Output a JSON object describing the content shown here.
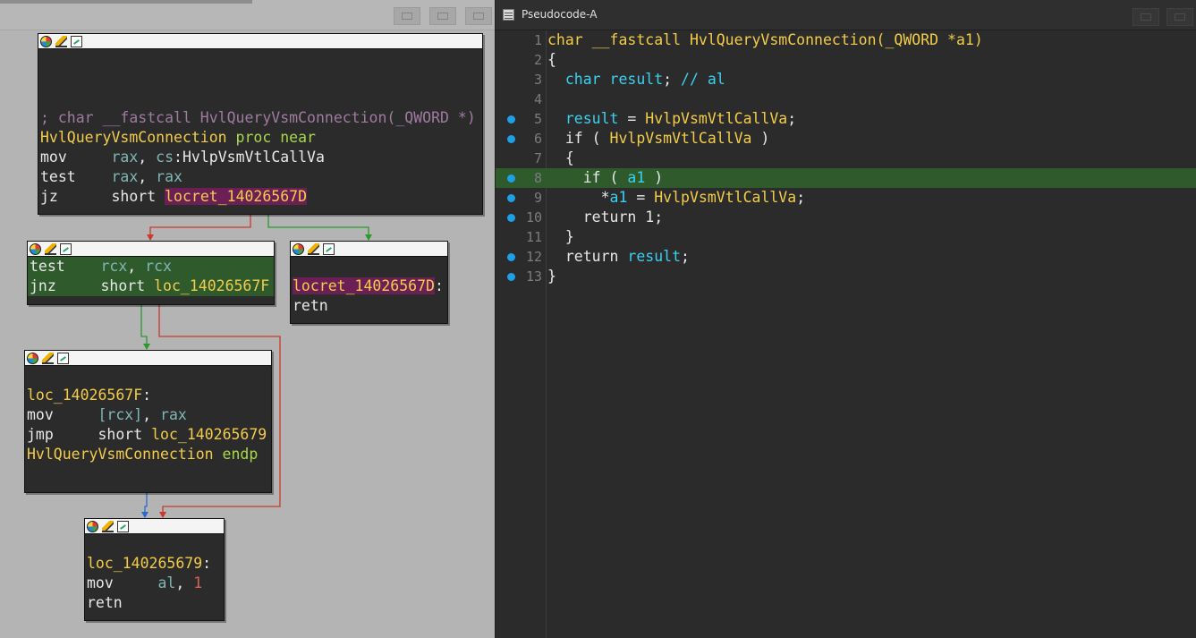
{
  "graph_view": {
    "nodes": [
      {
        "id": "entry",
        "lines": [
          {
            "tokens": [
              {
                "t": "; char __fastcall HvlQueryVsmConnection(_QWORD *)",
                "c": "gray"
              }
            ]
          },
          {
            "tokens": [
              {
                "t": "HvlQueryVsmConnection",
                "c": "yellow"
              },
              {
                "t": " proc near",
                "c": "lime"
              }
            ]
          },
          {
            "tokens": [
              {
                "t": "mov     ",
                "c": "white"
              },
              {
                "t": "rax",
                "c": "teal"
              },
              {
                "t": ", ",
                "c": "white"
              },
              {
                "t": "cs",
                "c": "teal"
              },
              {
                "t": ":HvlpVsmVtlCallVa",
                "c": "white"
              }
            ]
          },
          {
            "tokens": [
              {
                "t": "test    ",
                "c": "white"
              },
              {
                "t": "rax",
                "c": "teal"
              },
              {
                "t": ", ",
                "c": "white"
              },
              {
                "t": "rax",
                "c": "teal"
              }
            ]
          },
          {
            "tokens": [
              {
                "t": "jz      ",
                "c": "white"
              },
              {
                "t": "short ",
                "c": "white"
              },
              {
                "t": "locret_14026567D",
                "c": "label-hl"
              }
            ]
          }
        ]
      },
      {
        "id": "test_rcx",
        "lines": [
          {
            "tokens": [
              {
                "t": "test    ",
                "c": "white"
              },
              {
                "t": "rcx",
                "c": "teal"
              },
              {
                "t": ", ",
                "c": "white"
              },
              {
                "t": "rcx",
                "c": "teal"
              }
            ]
          },
          {
            "tokens": [
              {
                "t": "jnz     ",
                "c": "white"
              },
              {
                "t": "short ",
                "c": "white"
              },
              {
                "t": "loc_14026567F",
                "c": "yellow"
              }
            ]
          }
        ]
      },
      {
        "id": "locret",
        "lines": [
          {
            "tokens": [
              {
                "t": "locret_14026567D",
                "c": "label-hl"
              },
              {
                "t": ":",
                "c": "white"
              }
            ]
          },
          {
            "tokens": [
              {
                "t": "retn",
                "c": "white"
              }
            ]
          }
        ]
      },
      {
        "id": "loc_67F",
        "lines": [
          {
            "tokens": [
              {
                "t": "loc_14026567F",
                "c": "yellow"
              },
              {
                "t": ":",
                "c": "white"
              }
            ]
          },
          {
            "tokens": [
              {
                "t": "mov     ",
                "c": "white"
              },
              {
                "t": "[rcx]",
                "c": "teal"
              },
              {
                "t": ", ",
                "c": "white"
              },
              {
                "t": "rax",
                "c": "teal"
              }
            ]
          },
          {
            "tokens": [
              {
                "t": "jmp     ",
                "c": "white"
              },
              {
                "t": "short ",
                "c": "white"
              },
              {
                "t": "loc_140265679",
                "c": "yellow"
              }
            ]
          },
          {
            "tokens": [
              {
                "t": "HvlQueryVsmConnection",
                "c": "yellow"
              },
              {
                "t": " endp",
                "c": "lime"
              }
            ]
          }
        ]
      },
      {
        "id": "loc_679",
        "lines": [
          {
            "tokens": [
              {
                "t": "loc_140265679",
                "c": "yellow"
              },
              {
                "t": ":",
                "c": "white"
              }
            ]
          },
          {
            "tokens": [
              {
                "t": "mov     ",
                "c": "white"
              },
              {
                "t": "al",
                "c": "teal"
              },
              {
                "t": ", ",
                "c": "white"
              },
              {
                "t": "1",
                "c": "red"
              }
            ]
          },
          {
            "tokens": [
              {
                "t": "retn",
                "c": "white"
              }
            ]
          }
        ]
      }
    ]
  },
  "pseudocode": {
    "title": "Pseudocode-A",
    "lines": [
      {
        "n": "1",
        "dot": false,
        "hl": false,
        "tokens": [
          {
            "t": "char __fastcall HvlQueryVsmConnection(_QWORD *a1)",
            "c": "yellow"
          }
        ]
      },
      {
        "n": "2",
        "dot": false,
        "hl": false,
        "tokens": [
          {
            "t": "{",
            "c": "white"
          }
        ]
      },
      {
        "n": "3",
        "dot": false,
        "hl": false,
        "tokens": [
          {
            "t": "  char ",
            "c": "cyan"
          },
          {
            "t": "result",
            "c": "cyan"
          },
          {
            "t": "; ",
            "c": "white"
          },
          {
            "t": "// al",
            "c": "cyan"
          }
        ]
      },
      {
        "n": "4",
        "dot": false,
        "hl": false,
        "tokens": []
      },
      {
        "n": "5",
        "dot": true,
        "hl": false,
        "tokens": [
          {
            "t": "  result",
            "c": "cyan"
          },
          {
            "t": " = ",
            "c": "white"
          },
          {
            "t": "HvlpVsmVtlCallVa",
            "c": "yellow"
          },
          {
            "t": ";",
            "c": "white"
          }
        ]
      },
      {
        "n": "6",
        "dot": true,
        "hl": false,
        "tokens": [
          {
            "t": "  if ( ",
            "c": "white"
          },
          {
            "t": "HvlpVsmVtlCallVa",
            "c": "yellow"
          },
          {
            "t": " )",
            "c": "white"
          }
        ]
      },
      {
        "n": "7",
        "dot": false,
        "hl": false,
        "tokens": [
          {
            "t": "  {",
            "c": "white"
          }
        ]
      },
      {
        "n": "8",
        "dot": true,
        "hl": true,
        "tokens": [
          {
            "t": "    if ( ",
            "c": "white"
          },
          {
            "t": "a1",
            "c": "cyan"
          },
          {
            "t": " )",
            "c": "white"
          }
        ]
      },
      {
        "n": "9",
        "dot": true,
        "hl": false,
        "tokens": [
          {
            "t": "      *",
            "c": "white"
          },
          {
            "t": "a1",
            "c": "cyan"
          },
          {
            "t": " = ",
            "c": "white"
          },
          {
            "t": "HvlpVsmVtlCallVa",
            "c": "yellow"
          },
          {
            "t": ";",
            "c": "white"
          }
        ]
      },
      {
        "n": "10",
        "dot": true,
        "hl": false,
        "tokens": [
          {
            "t": "    return 1;",
            "c": "white"
          }
        ]
      },
      {
        "n": "11",
        "dot": false,
        "hl": false,
        "tokens": [
          {
            "t": "  }",
            "c": "white"
          }
        ]
      },
      {
        "n": "12",
        "dot": true,
        "hl": false,
        "tokens": [
          {
            "t": "  return ",
            "c": "white"
          },
          {
            "t": "result",
            "c": "cyan"
          },
          {
            "t": ";",
            "c": "white"
          }
        ]
      },
      {
        "n": "13",
        "dot": true,
        "hl": false,
        "tokens": [
          {
            "t": "}",
            "c": "white"
          }
        ]
      }
    ]
  },
  "colors": {
    "edge_true": "#2a9a2a",
    "edge_false": "#c83a2a",
    "edge_uncond": "#2a6ad0",
    "highlight_line": "#2e5a2c",
    "breakpoint_dot": "#1ea0e6"
  }
}
